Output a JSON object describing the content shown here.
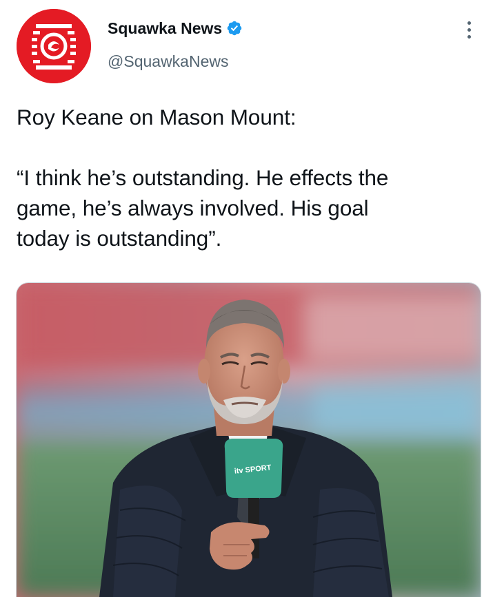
{
  "author": {
    "display_name": "Squawka News",
    "handle": "@SquawkaNews",
    "verified": true,
    "avatar_icon": "squawka-logo-icon",
    "brand_color": "#e41b24"
  },
  "tweet": {
    "lines": [
      "Roy Keane on Mason Mount:",
      "",
      "“I think he’s outstanding. He effects the",
      "game, he’s always involved. His goal",
      "today is outstanding”."
    ]
  },
  "media": {
    "microphone_label": "itv SPORT"
  },
  "icons": {
    "verified": "verified-badge-icon",
    "more": "more-options-icon"
  },
  "colors": {
    "text": "#0f1419",
    "secondary": "#536471",
    "verified": "#1d9bf0",
    "mic": "#3aa58b"
  }
}
